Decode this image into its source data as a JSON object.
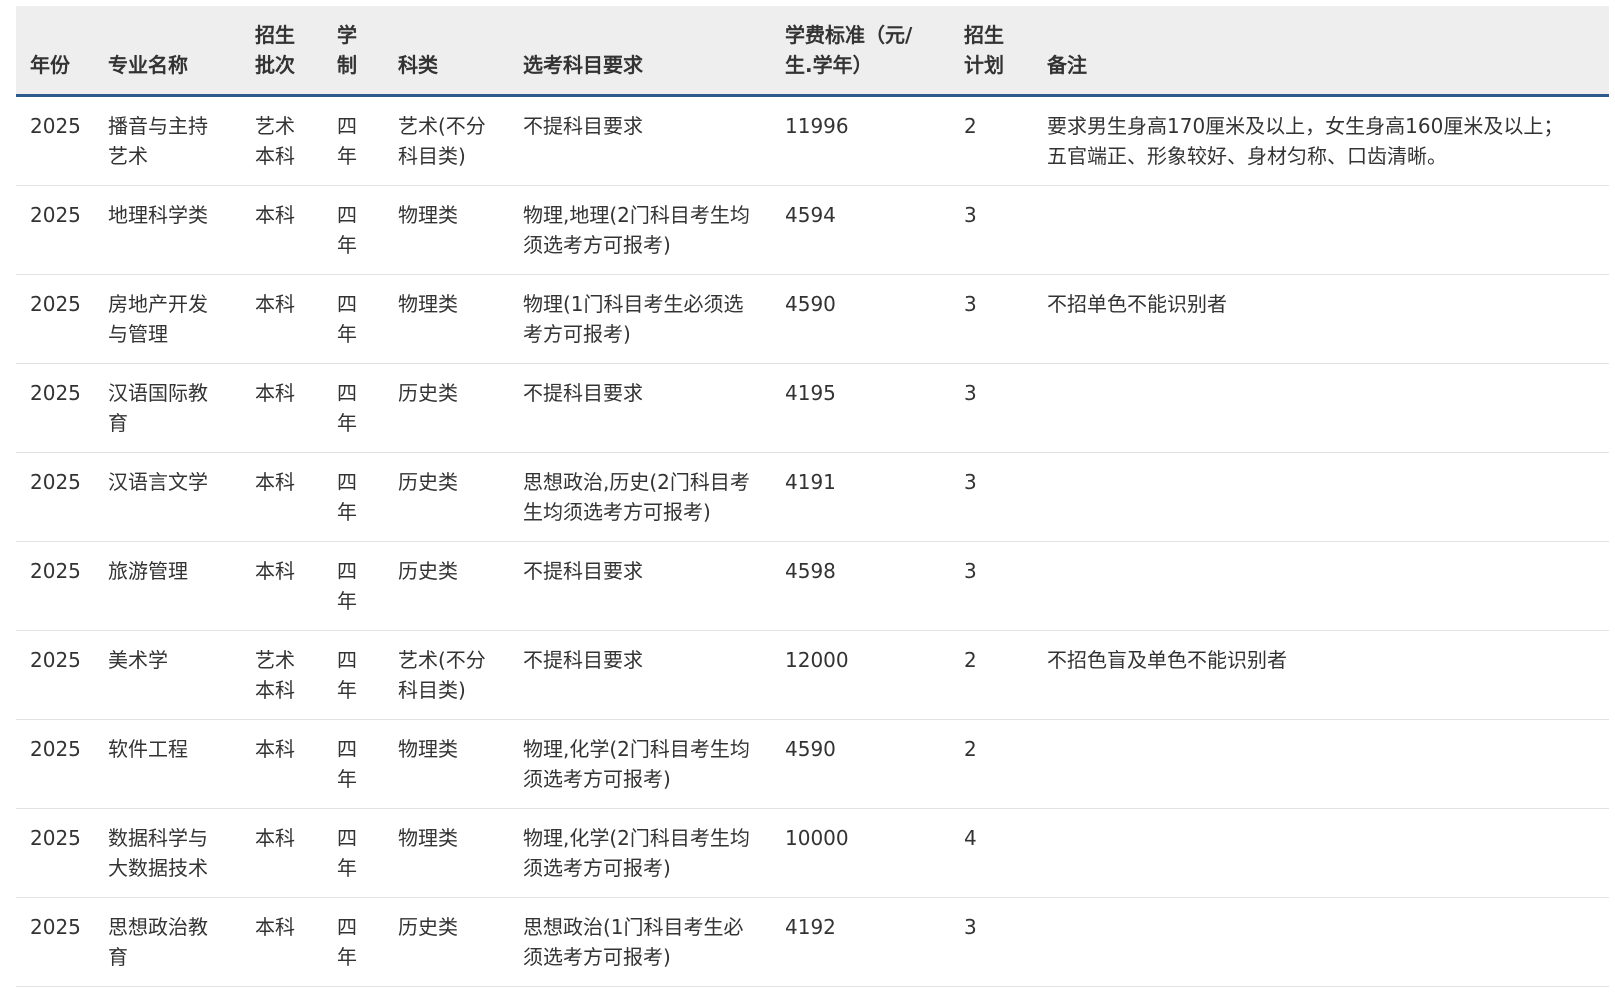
{
  "table": {
    "headers": [
      "年份",
      "专业名称",
      "招生批次",
      "学制",
      "科类",
      "选考科目要求",
      "学费标准（元/生.学年）",
      "招生计划",
      "备注"
    ],
    "rows": [
      [
        "2025",
        "播音与主持艺术",
        "艺术本科",
        "四年",
        "艺术(不分科目类)",
        "不提科目要求",
        "11996",
        "2",
        "要求男生身高170厘米及以上，女生身高160厘米及以上；五官端正、形象较好、身材匀称、口齿清晰。"
      ],
      [
        "2025",
        "地理科学类",
        "本科",
        "四年",
        "物理类",
        "物理,地理(2门科目考生均须选考方可报考)",
        "4594",
        "3",
        ""
      ],
      [
        "2025",
        "房地产开发与管理",
        "本科",
        "四年",
        "物理类",
        "物理(1门科目考生必须选考方可报考)",
        "4590",
        "3",
        "不招单色不能识别者"
      ],
      [
        "2025",
        "汉语国际教育",
        "本科",
        "四年",
        "历史类",
        "不提科目要求",
        "4195",
        "3",
        ""
      ],
      [
        "2025",
        "汉语言文学",
        "本科",
        "四年",
        "历史类",
        "思想政治,历史(2门科目考生均须选考方可报考)",
        "4191",
        "3",
        ""
      ],
      [
        "2025",
        "旅游管理",
        "本科",
        "四年",
        "历史类",
        "不提科目要求",
        "4598",
        "3",
        ""
      ],
      [
        "2025",
        "美术学",
        "艺术本科",
        "四年",
        "艺术(不分科目类)",
        "不提科目要求",
        "12000",
        "2",
        "不招色盲及单色不能识别者"
      ],
      [
        "2025",
        "软件工程",
        "本科",
        "四年",
        "物理类",
        "物理,化学(2门科目考生均须选考方可报考)",
        "4590",
        "2",
        ""
      ],
      [
        "2025",
        "数据科学与大数据技术",
        "本科",
        "四年",
        "物理类",
        "物理,化学(2门科目考生均须选考方可报考)",
        "10000",
        "4",
        ""
      ],
      [
        "2025",
        "思想政治教育",
        "本科",
        "四年",
        "历史类",
        "思想政治(1门科目考生必须选考方可报考)",
        "4192",
        "3",
        ""
      ]
    ]
  }
}
